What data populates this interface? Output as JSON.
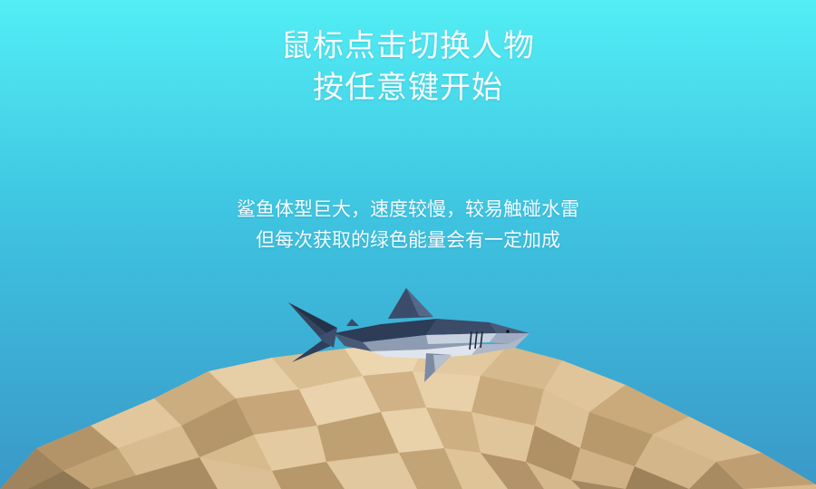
{
  "title": {
    "line1": "鼠标点击切换人物",
    "line2": "按任意键开始"
  },
  "description": {
    "line1": "鲨鱼体型巨大，速度较慢，较易触碰水雷",
    "line2": "但每次获取的绿色能量会有一定加成"
  },
  "character": {
    "icon": "shark-icon"
  },
  "colors": {
    "sky_top": "#52eef5",
    "sky_bottom": "#3a98c8",
    "sand_light": "#e2c79c",
    "sand_dark": "#a48c66",
    "shark_dark": "#2b3a52",
    "shark_light": "#cfd8e6"
  }
}
